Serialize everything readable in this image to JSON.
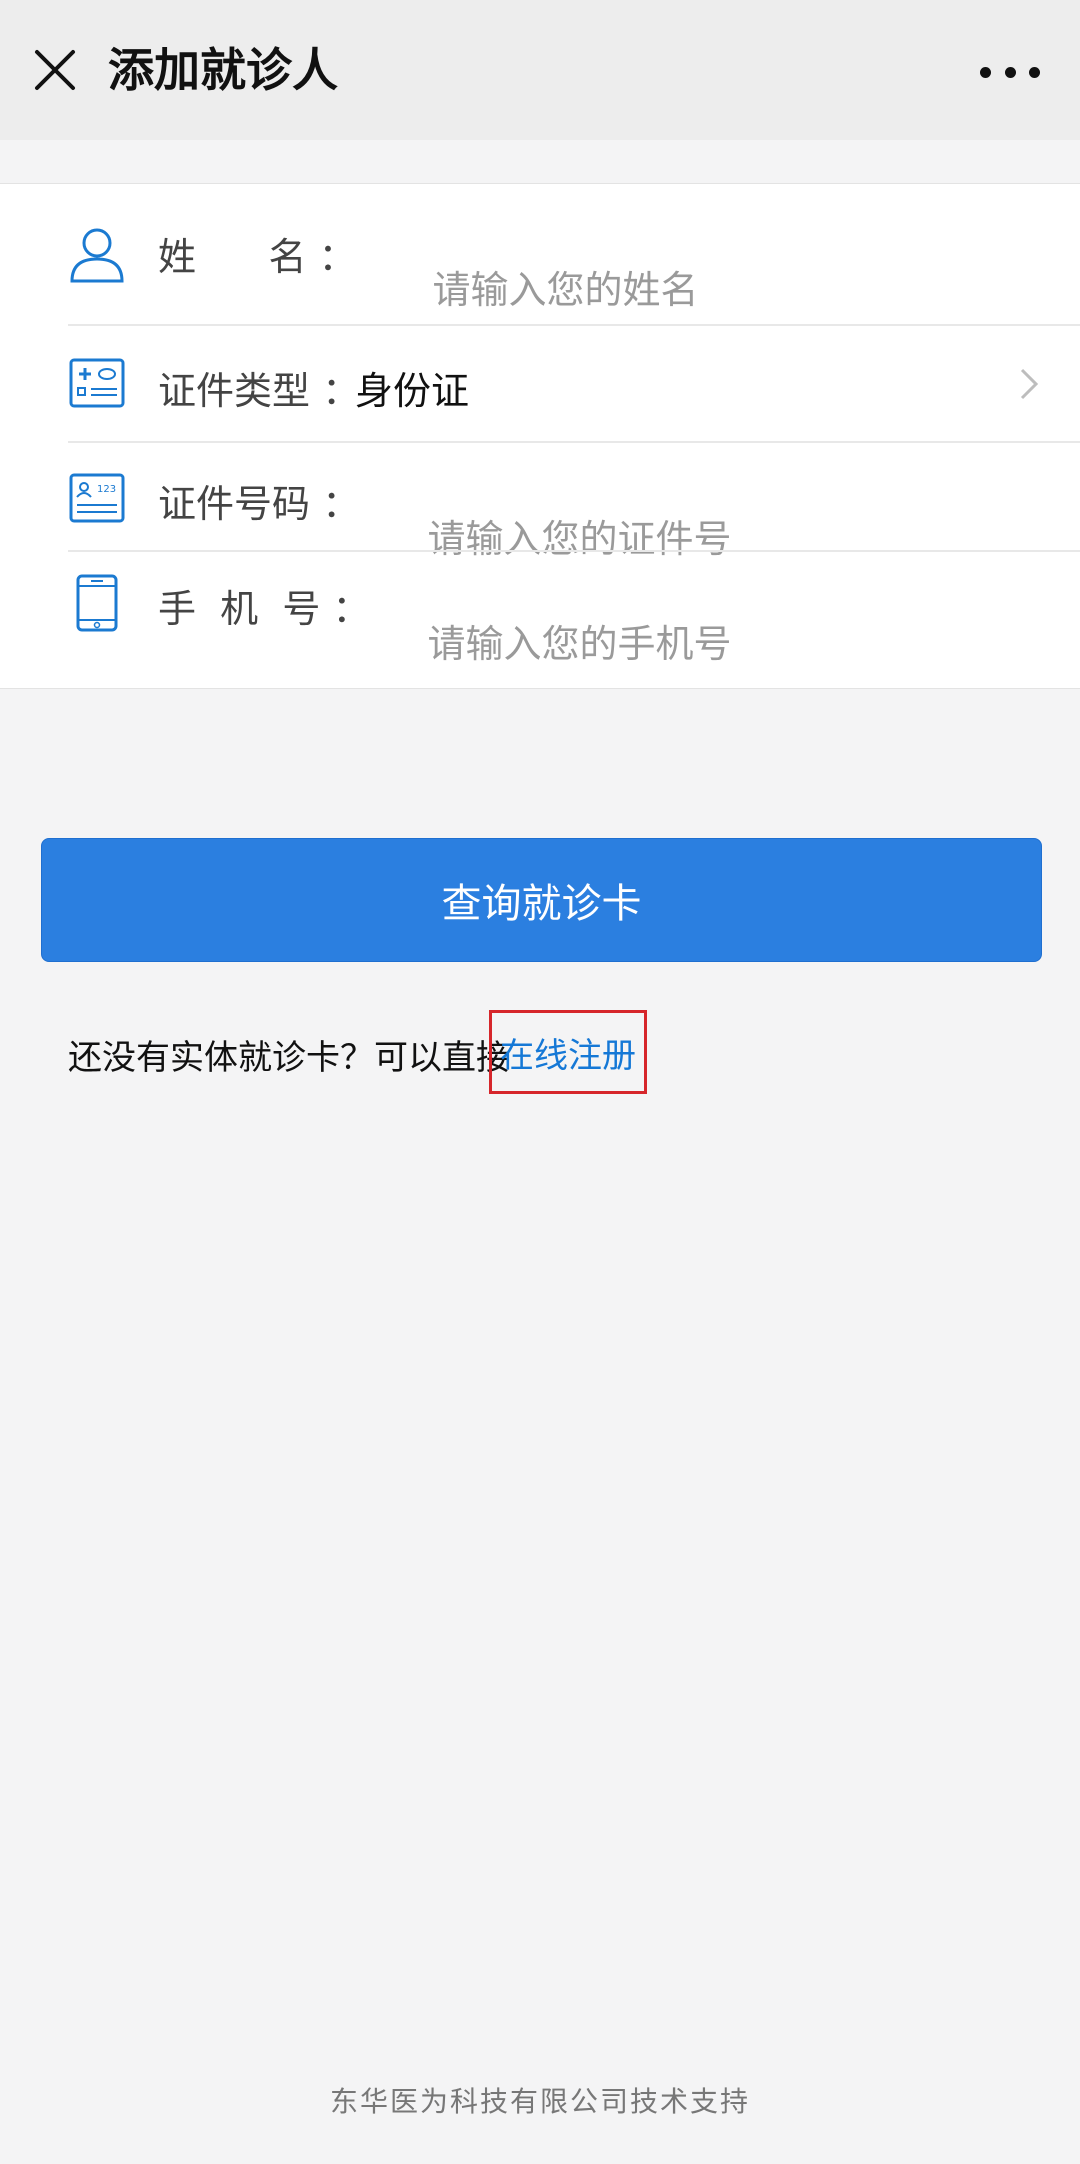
{
  "header": {
    "title": "添加就诊人"
  },
  "form": {
    "name": {
      "label": "姓      名 ：",
      "placeholder": "请输入您的姓名"
    },
    "id_type": {
      "label": "证件类型 ：",
      "value": "身份证"
    },
    "id_number": {
      "label": "证件号码 ：",
      "placeholder": "请输入您的证件号"
    },
    "phone": {
      "label": "手  机  号 ：",
      "placeholder": "请输入您的手机号"
    }
  },
  "actions": {
    "query_button": "查询就诊卡",
    "register_prompt": "还没有实体就诊卡？可以直接",
    "register_link": "在线注册"
  },
  "footer": {
    "support_text": "东华医为科技有限公司技术支持"
  },
  "colors": {
    "primary": "#2b7fe0",
    "link": "#1578d6",
    "highlight_border": "#d6262b",
    "icon_blue": "#1b7ad1"
  },
  "icons": {
    "close": "close-icon",
    "more": "more-icon",
    "name": "user-icon",
    "id_type": "id-card-type-icon",
    "id_number": "id-card-number-icon",
    "phone": "phone-icon",
    "chevron": "chevron-right-icon"
  }
}
